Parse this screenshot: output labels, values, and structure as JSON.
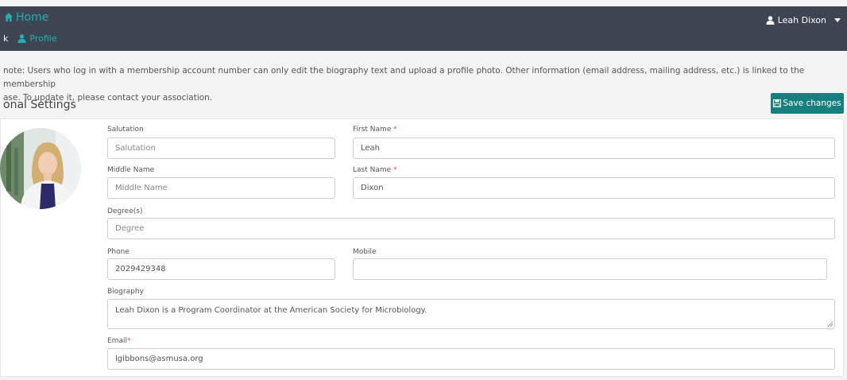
{
  "header": {
    "home_label": "Home",
    "back_label": "k",
    "profile_label": "Profile",
    "user_name": "Leah Dixon"
  },
  "notice": {
    "line1": "note: Users who log in with a membership account number can only edit the biography text and upload a profile photo. Other information (email address, mailing address, etc.) is linked to the membership",
    "line2": "ase. To update it, please contact your association."
  },
  "section": {
    "title": "onal Settings",
    "save_label": "Save changes"
  },
  "form": {
    "salutation": {
      "label": "Salutation",
      "placeholder": "Salutation",
      "value": ""
    },
    "first_name": {
      "label": "First Name",
      "required": "*",
      "value": "Leah"
    },
    "middle_name": {
      "label": "Middle Name",
      "placeholder": "Middle Name",
      "value": ""
    },
    "last_name": {
      "label": "Last Name",
      "required": "*",
      "value": "Dixon"
    },
    "degree": {
      "label": "Degree(s)",
      "placeholder": "Degree",
      "value": ""
    },
    "phone": {
      "label": "Phone",
      "value": "2029429348"
    },
    "mobile": {
      "label": "Mobile",
      "value": ""
    },
    "biography": {
      "label": "Biography",
      "value": "Leah Dixon is a Program Coordinator at the American Society for Microbiology."
    },
    "email": {
      "label": "Email",
      "required": "*",
      "value": "lgibbons@asmusa.org"
    }
  },
  "colors": {
    "topbar": "#3e4552",
    "accent": "#22b1b1",
    "save_button": "#17807e",
    "required": "#d9534f"
  },
  "icons": [
    "home-icon",
    "user-icon",
    "floppy-disk-icon",
    "caret-down-icon"
  ]
}
